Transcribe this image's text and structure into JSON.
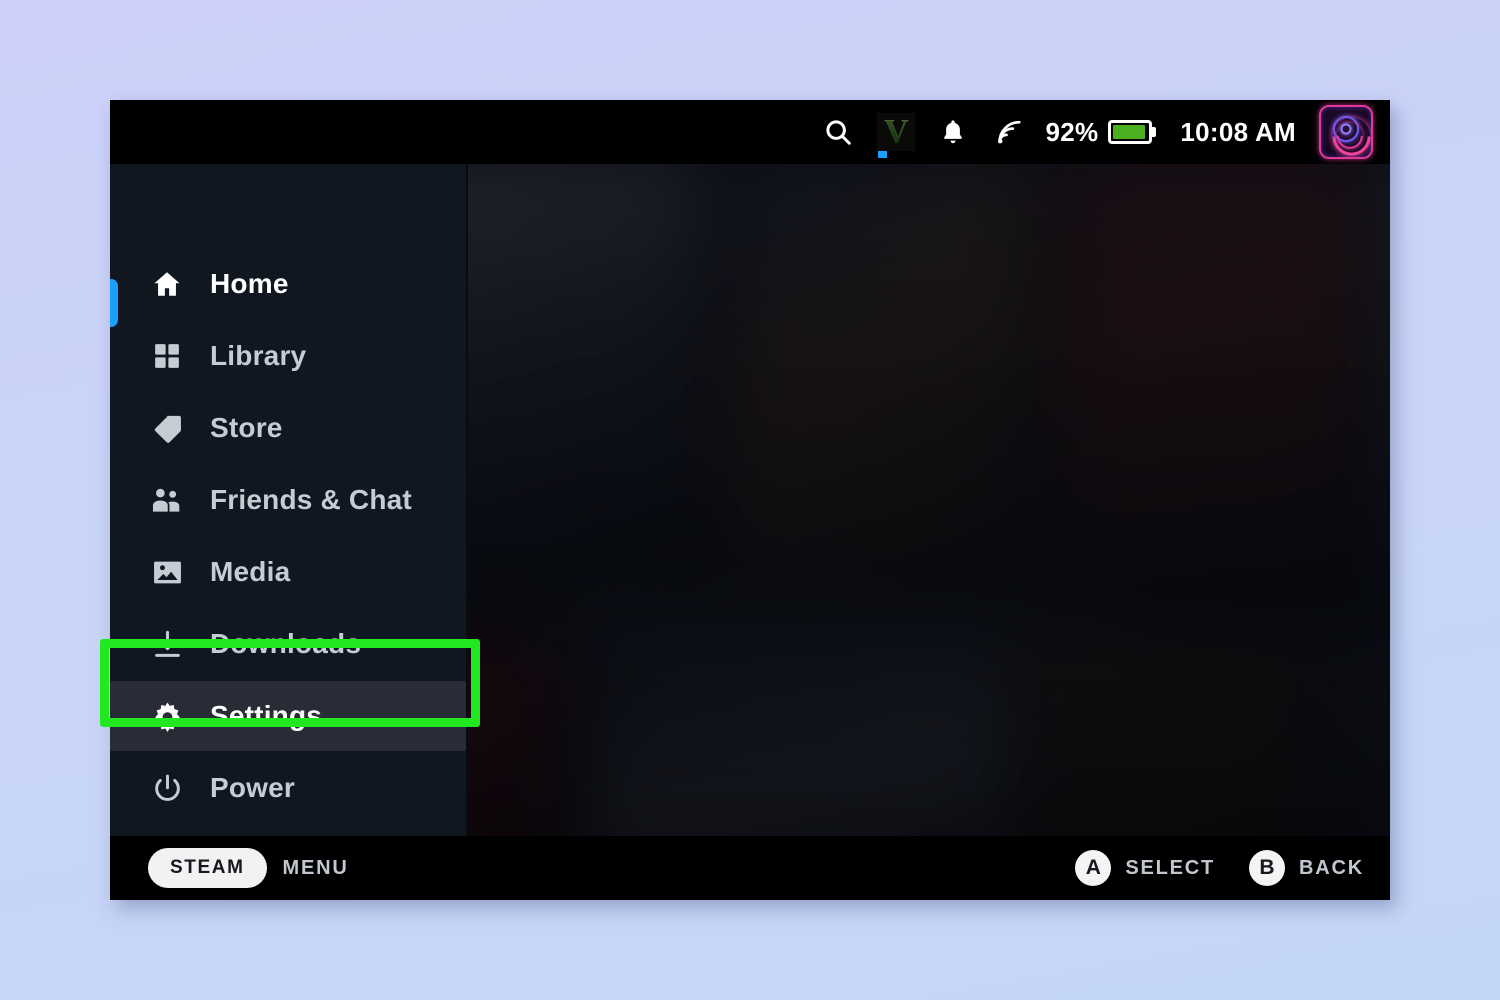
{
  "device": {
    "label": "steam-deck-screen"
  },
  "status_bar": {
    "search_icon": "search-icon",
    "game_logo": {
      "glyph": "V",
      "name": "gta-v-logo",
      "running_indicator": true
    },
    "notifications_icon": "bell-icon",
    "network_icon": "wifi-signal-icon",
    "battery_percent": "92%",
    "battery_level": 92,
    "battery_color": "#4caf20",
    "clock": "10:08 AM",
    "avatar": "user-avatar"
  },
  "sidebar": {
    "items": [
      {
        "id": "home",
        "label": "Home",
        "icon": "home-icon",
        "active": true,
        "selected": false
      },
      {
        "id": "library",
        "label": "Library",
        "icon": "grid-icon",
        "active": false,
        "selected": false
      },
      {
        "id": "store",
        "label": "Store",
        "icon": "tag-icon",
        "active": false,
        "selected": false
      },
      {
        "id": "friends",
        "label": "Friends & Chat",
        "icon": "people-icon",
        "active": false,
        "selected": false
      },
      {
        "id": "media",
        "label": "Media",
        "icon": "image-icon",
        "active": false,
        "selected": false
      },
      {
        "id": "downloads",
        "label": "Downloads",
        "icon": "download-icon",
        "active": false,
        "selected": false
      },
      {
        "id": "settings",
        "label": "Settings",
        "icon": "gear-icon",
        "active": false,
        "selected": true
      },
      {
        "id": "power",
        "label": "Power",
        "icon": "power-icon",
        "active": false,
        "selected": false
      }
    ],
    "active_accent_color": "#1a9fff",
    "selected_row_color": "#272c37"
  },
  "bottom_bar": {
    "steam_button": "STEAM",
    "menu_label": "MENU",
    "actions": [
      {
        "button": "A",
        "label": "SELECT"
      },
      {
        "button": "B",
        "label": "BACK"
      }
    ]
  },
  "annotation": {
    "target": "Settings",
    "color": "#22e821"
  },
  "colors": {
    "page_background": "#c9d4f5",
    "status_bar": "#000000",
    "sidebar": "#111720",
    "content": "#0f131b"
  }
}
